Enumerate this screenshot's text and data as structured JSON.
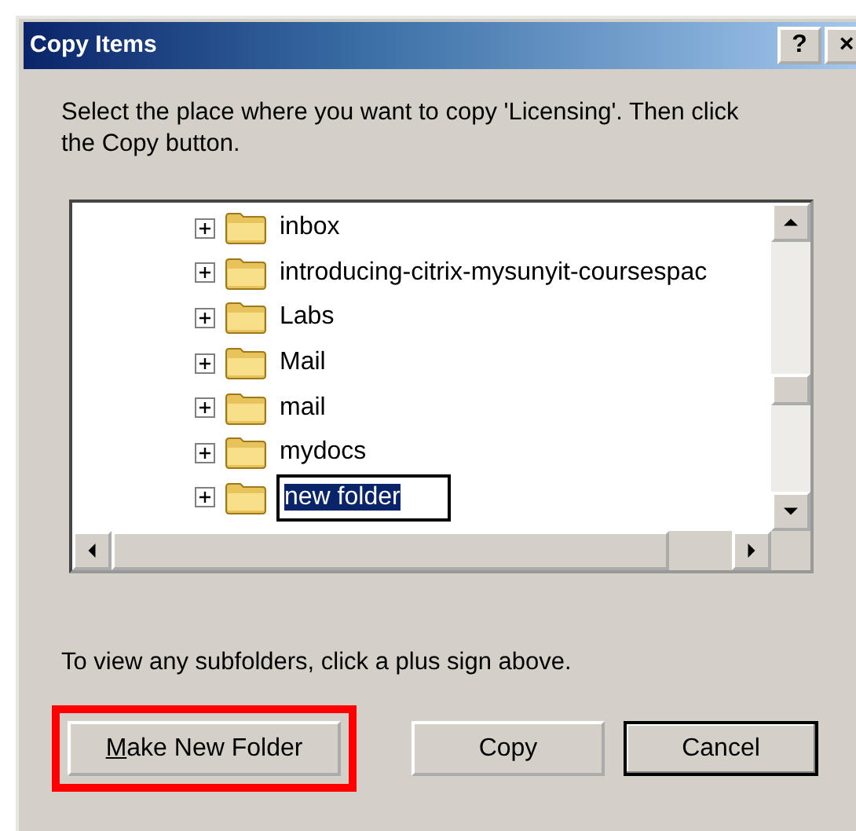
{
  "window": {
    "title": "Copy Items",
    "title_buttons": [
      "?",
      "×"
    ]
  },
  "instruction": "Select the place where you want to copy 'Licensing'. Then click the Copy button.",
  "tree": {
    "items": [
      {
        "label": "inbox",
        "expandable": true,
        "editing": false
      },
      {
        "label": "introducing-citrix-mysunyit-coursespac",
        "expandable": true,
        "editing": false
      },
      {
        "label": "Labs",
        "expandable": true,
        "editing": false
      },
      {
        "label": "Mail",
        "expandable": true,
        "editing": false
      },
      {
        "label": "mail",
        "expandable": true,
        "editing": false
      },
      {
        "label": "mydocs",
        "expandable": true,
        "editing": false
      },
      {
        "label": "new folder",
        "expandable": true,
        "editing": true
      }
    ]
  },
  "hint": "To view any subfolders, click a plus sign above.",
  "buttons": [
    {
      "label": "Make New Folder",
      "mnemonic": true,
      "highlighted": true,
      "default": false
    },
    {
      "label": "Copy",
      "mnemonic": false,
      "highlighted": false,
      "default": false
    },
    {
      "label": "Cancel",
      "mnemonic": false,
      "highlighted": false,
      "default": true
    }
  ]
}
